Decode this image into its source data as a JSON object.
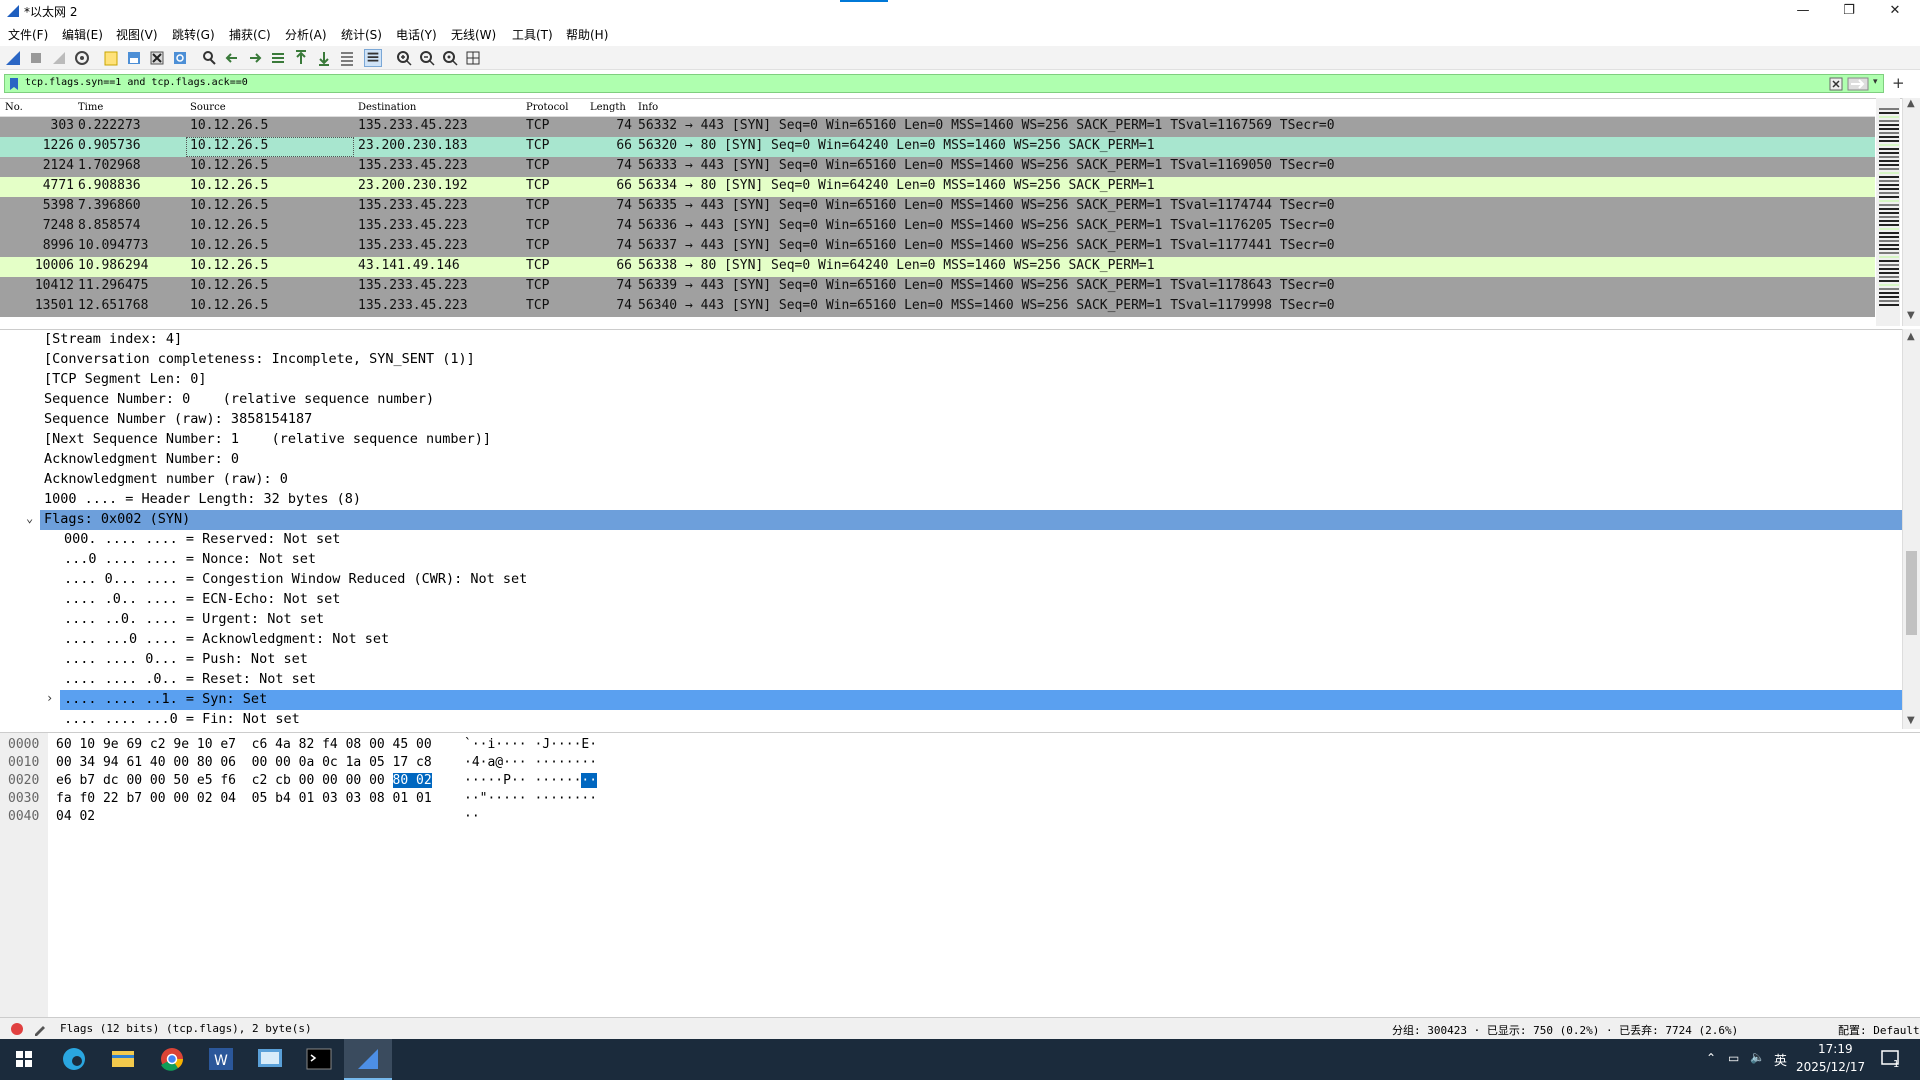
{
  "window": {
    "title": "*以太网 2"
  },
  "menu": [
    "文件(F)",
    "编辑(E)",
    "视图(V)",
    "跳转(G)",
    "捕获(C)",
    "分析(A)",
    "统计(S)",
    "电话(Y)",
    "无线(W)",
    "工具(T)",
    "帮助(H)"
  ],
  "filter": {
    "value": "tcp.flags.syn==1 and tcp.flags.ack==0",
    "add_label": "+"
  },
  "packet_list": {
    "columns": [
      "No.",
      "Time",
      "Source",
      "Destination",
      "Protocol",
      "Length",
      "Info"
    ],
    "rows": [
      {
        "no": "303",
        "time": "0.222273",
        "src": "10.12.26.5",
        "dst": "135.233.45.223",
        "proto": "TCP",
        "len": "74",
        "info": "56332 → 443 [SYN] Seq=0 Win=65160 Len=0 MSS=1460 WS=256 SACK_PERM=1 TSval=1167569 TSecr=0",
        "bg": "#a0a0a0"
      },
      {
        "no": "1226",
        "time": "0.905736",
        "src": "10.12.26.5",
        "dst": "23.200.230.183",
        "proto": "TCP",
        "len": "66",
        "info": "56320 → 80 [SYN] Seq=0 Win=64240 Len=0 MSS=1460 WS=256 SACK_PERM=1",
        "bg": "#a8e6cf"
      },
      {
        "no": "2124",
        "time": "1.702968",
        "src": "10.12.26.5",
        "dst": "135.233.45.223",
        "proto": "TCP",
        "len": "74",
        "info": "56333 → 443 [SYN] Seq=0 Win=65160 Len=0 MSS=1460 WS=256 SACK_PERM=1 TSval=1169050 TSecr=0",
        "bg": "#a0a0a0"
      },
      {
        "no": "4771",
        "time": "6.908836",
        "src": "10.12.26.5",
        "dst": "23.200.230.192",
        "proto": "TCP",
        "len": "66",
        "info": "56334 → 80 [SYN] Seq=0 Win=64240 Len=0 MSS=1460 WS=256 SACK_PERM=1",
        "bg": "#e4ffc7"
      },
      {
        "no": "5398",
        "time": "7.396860",
        "src": "10.12.26.5",
        "dst": "135.233.45.223",
        "proto": "TCP",
        "len": "74",
        "info": "56335 → 443 [SYN] Seq=0 Win=65160 Len=0 MSS=1460 WS=256 SACK_PERM=1 TSval=1174744 TSecr=0",
        "bg": "#a0a0a0"
      },
      {
        "no": "7248",
        "time": "8.858574",
        "src": "10.12.26.5",
        "dst": "135.233.45.223",
        "proto": "TCP",
        "len": "74",
        "info": "56336 → 443 [SYN] Seq=0 Win=65160 Len=0 MSS=1460 WS=256 SACK_PERM=1 TSval=1176205 TSecr=0",
        "bg": "#a0a0a0"
      },
      {
        "no": "8996",
        "time": "10.094773",
        "src": "10.12.26.5",
        "dst": "135.233.45.223",
        "proto": "TCP",
        "len": "74",
        "info": "56337 → 443 [SYN] Seq=0 Win=65160 Len=0 MSS=1460 WS=256 SACK_PERM=1 TSval=1177441 TSecr=0",
        "bg": "#a0a0a0"
      },
      {
        "no": "10006",
        "time": "10.986294",
        "src": "10.12.26.5",
        "dst": "43.141.49.146",
        "proto": "TCP",
        "len": "66",
        "info": "56338 → 80 [SYN] Seq=0 Win=64240 Len=0 MSS=1460 WS=256 SACK_PERM=1",
        "bg": "#e4ffc7"
      },
      {
        "no": "10412",
        "time": "11.296475",
        "src": "10.12.26.5",
        "dst": "135.233.45.223",
        "proto": "TCP",
        "len": "74",
        "info": "56339 → 443 [SYN] Seq=0 Win=65160 Len=0 MSS=1460 WS=256 SACK_PERM=1 TSval=1178643 TSecr=0",
        "bg": "#a0a0a0"
      },
      {
        "no": "13501",
        "time": "12.651768",
        "src": "10.12.26.5",
        "dst": "135.233.45.223",
        "proto": "TCP",
        "len": "74",
        "info": "56340 → 443 [SYN] Seq=0 Win=65160 Len=0 MSS=1460 WS=256 SACK_PERM=1 TSval=1179998 TSecr=0",
        "bg": "#a0a0a0"
      }
    ]
  },
  "details": {
    "rows": [
      {
        "text": "[Stream index: 4]",
        "indent": 0
      },
      {
        "text": "[Conversation completeness: Incomplete, SYN_SENT (1)]",
        "indent": 0
      },
      {
        "text": "[TCP Segment Len: 0]",
        "indent": 0
      },
      {
        "text": "Sequence Number: 0    (relative sequence number)",
        "indent": 0
      },
      {
        "text": "Sequence Number (raw): 3858154187",
        "indent": 0
      },
      {
        "text": "[Next Sequence Number: 1    (relative sequence number)]",
        "indent": 0
      },
      {
        "text": "Acknowledgment Number: 0",
        "indent": 0
      },
      {
        "text": "Acknowledgment number (raw): 0",
        "indent": 0
      },
      {
        "text": "1000 .... = Header Length: 32 bytes (8)",
        "indent": 0
      },
      {
        "text": "Flags: 0x002 (SYN)",
        "indent": 0,
        "expanded": true,
        "selected": "parent"
      },
      {
        "text": "000. .... .... = Reserved: Not set",
        "indent": 1
      },
      {
        "text": "...0 .... .... = Nonce: Not set",
        "indent": 1
      },
      {
        "text": ".... 0... .... = Congestion Window Reduced (CWR): Not set",
        "indent": 1
      },
      {
        "text": ".... .0.. .... = ECN-Echo: Not set",
        "indent": 1
      },
      {
        "text": ".... ..0. .... = Urgent: Not set",
        "indent": 1
      },
      {
        "text": ".... ...0 .... = Acknowledgment: Not set",
        "indent": 1
      },
      {
        "text": ".... .... 0... = Push: Not set",
        "indent": 1
      },
      {
        "text": ".... .... .0.. = Reset: Not set",
        "indent": 1
      },
      {
        "text": ".... .... ..1. = Syn: Set",
        "indent": 1,
        "collapsed": true,
        "selected": "child"
      },
      {
        "text": ".... .... ...0 = Fin: Not set",
        "indent": 1
      }
    ]
  },
  "bytes": {
    "rows": [
      {
        "offset": "0000",
        "hex_a": "60 10 9e 69 c2 9e 10 e7  c6 4a 82 f4 08 00 45 00",
        "hex_hl": "",
        "ascii_a": "`··i···· ·J····E·",
        "ascii_hl": ""
      },
      {
        "offset": "0010",
        "hex_a": "00 34 94 61 40 00 80 06  00 00 0a 0c 1a 05 17 c8",
        "hex_hl": "",
        "ascii_a": "·4·a@··· ········",
        "ascii_hl": ""
      },
      {
        "offset": "0020",
        "hex_a": "e6 b7 dc 00 00 50 e5 f6  c2 cb 00 00 00 00 ",
        "hex_hl": "80 02",
        "ascii_a": "·····P·· ······",
        "ascii_hl": "··"
      },
      {
        "offset": "0030",
        "hex_a": "fa f0 22 b7 00 00 02 04  05 b4 01 03 03 08 01 01",
        "hex_hl": "",
        "ascii_a": "··\"····· ········",
        "ascii_hl": ""
      },
      {
        "offset": "0040",
        "hex_a": "04 02",
        "hex_hl": "",
        "ascii_a": "··",
        "ascii_hl": ""
      }
    ]
  },
  "status": {
    "field_info": "Flags (12 bits) (tcp.flags), 2 byte(s)",
    "counts": "分组: 300423 · 已显示: 750 (0.2%) · 已丢弃: 7724 (2.6%)",
    "profile": "配置: Default"
  },
  "taskbar": {
    "time": "17:19",
    "date": "2025/12/17",
    "ime": "英",
    "notif": "1"
  }
}
